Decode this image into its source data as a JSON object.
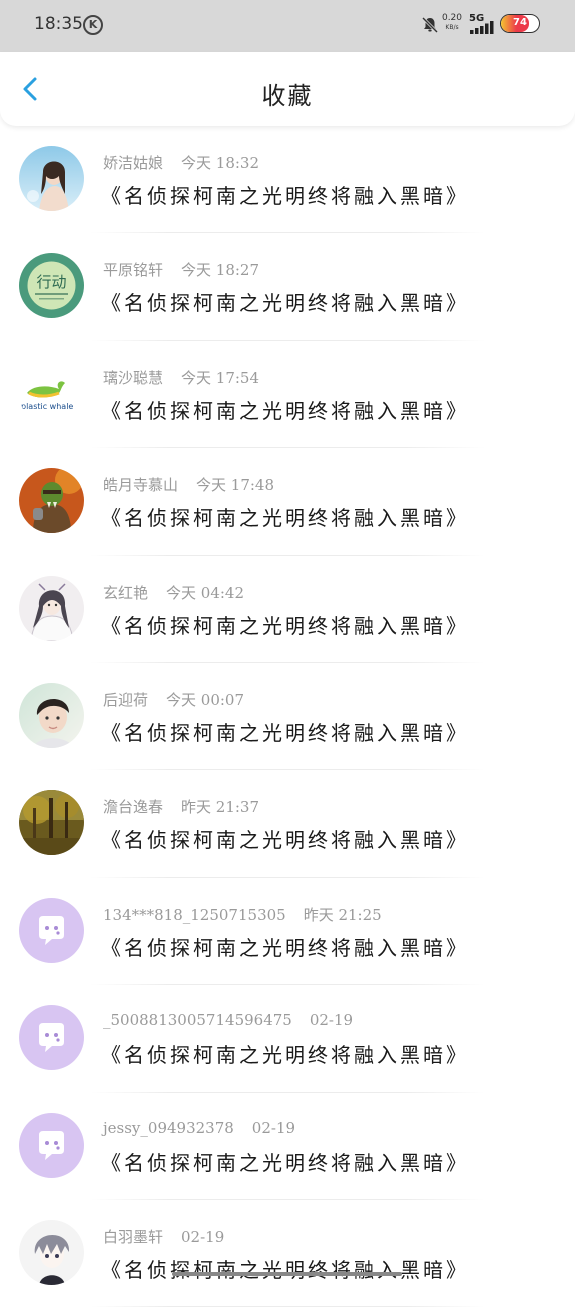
{
  "status_bar": {
    "time": "18:35",
    "k_icon_label": "K",
    "net_speed_value": "0.20",
    "net_speed_unit": "KB/s",
    "network_type": "5G",
    "battery_level": "74",
    "battery_fraction": 0.74
  },
  "header": {
    "title": "收藏"
  },
  "favorites": [
    {
      "user": "娇洁姑娘",
      "time": "今天 18:32",
      "title": "《名侦探柯南之光明终将融入黑暗》",
      "avatar": "photo-girl-blue"
    },
    {
      "user": "平原铭轩",
      "time": "今天 18:27",
      "title": "《名侦探柯南之光明终将融入黑暗》",
      "avatar": "logo-xingdong"
    },
    {
      "user": "璃沙聪慧",
      "time": "今天 17:54",
      "title": "《名侦探柯南之光明终将融入黑暗》",
      "avatar": "logo-plastic-whale"
    },
    {
      "user": "皓月寺慕山",
      "time": "今天 17:48",
      "title": "《名侦探柯南之光明终将融入黑暗》",
      "avatar": "photo-orc-warrior"
    },
    {
      "user": "玄红艳",
      "time": "今天 04:42",
      "title": "《名侦探柯南之光明终将融入黑暗》",
      "avatar": "drawing-anime-man"
    },
    {
      "user": "后迎荷",
      "time": "今天 00:07",
      "title": "《名侦探柯南之光明终将融入黑暗》",
      "avatar": "photo-boy"
    },
    {
      "user": "澹台逸春",
      "time": "昨天 21:37",
      "title": "《名侦探柯南之光明终将融入黑暗》",
      "avatar": "photo-forest"
    },
    {
      "user": "134***818_1250715305",
      "time": "昨天 21:25",
      "title": "《名侦探柯南之光明终将融入黑暗》",
      "avatar": "default-chat-avatar"
    },
    {
      "user": "_5008813005714596475",
      "time": "02-19",
      "title": "《名侦探柯南之光明终将融入黑暗》",
      "avatar": "default-chat-avatar"
    },
    {
      "user": "jessy_094932378",
      "time": "02-19",
      "title": "《名侦探柯南之光明终将融入黑暗》",
      "avatar": "default-chat-avatar"
    },
    {
      "user": "白羽墨轩",
      "time": "02-19",
      "title": "《名侦探柯南之光明终将融入黑暗》",
      "avatar": "drawing-anime-boy"
    }
  ],
  "colors": {
    "status_bar_bg": "#d8d8d8",
    "back_arrow": "#2aa0e0",
    "default_avatar_bg": "#d8c5f2",
    "meta_text": "#9a9a9a",
    "title_text": "#1a1a1a"
  }
}
